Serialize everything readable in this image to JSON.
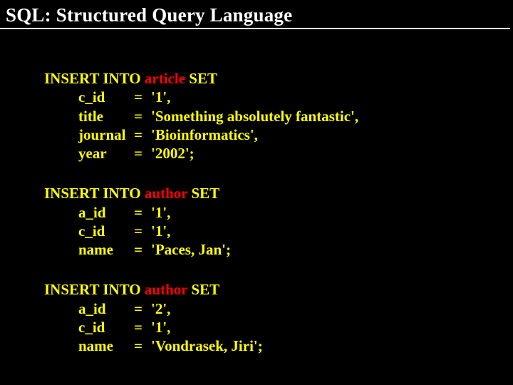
{
  "title": "SQL: Structured Query Language",
  "kw_insert_into": "INSERT INTO",
  "kw_set": "SET",
  "eq": "=",
  "statements": [
    {
      "table": "article",
      "rows": [
        {
          "col": "c_id",
          "val": "'1',"
        },
        {
          "col": "title",
          "val": "'Something absolutely fantastic',"
        },
        {
          "col": "journal",
          "val": "'Bioinformatics',"
        },
        {
          "col": "year",
          "val": "'2002';"
        }
      ]
    },
    {
      "table": "author",
      "rows": [
        {
          "col": "a_id",
          "val": "'1',"
        },
        {
          "col": "c_id",
          "val": "'1',"
        },
        {
          "col": "name",
          "val": "'Paces, Jan';"
        }
      ]
    },
    {
      "table": "author",
      "rows": [
        {
          "col": "a_id",
          "val": "'2',"
        },
        {
          "col": "c_id",
          "val": "'1',"
        },
        {
          "col": "name",
          "val": "'Vondrasek, Jiri';"
        }
      ]
    }
  ]
}
